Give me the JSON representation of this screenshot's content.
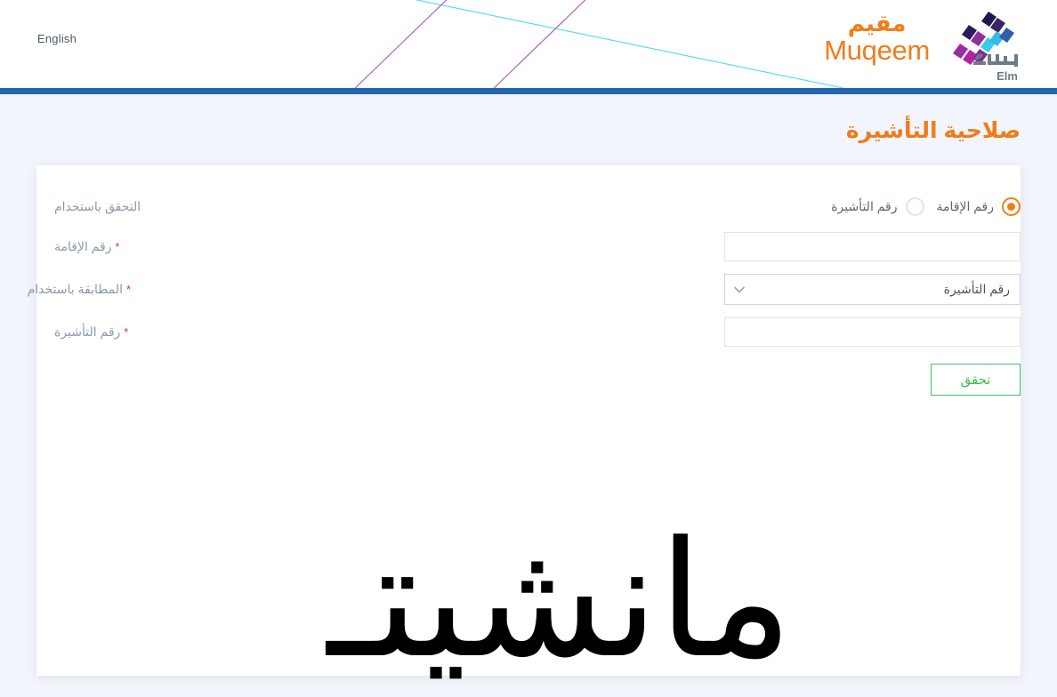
{
  "header": {
    "language_link": "English",
    "brand": {
      "name_ar": "مقيم",
      "name_en": "Muqeem",
      "partner_name": "Elm"
    },
    "accent_color": "#f07d1b",
    "bar_color": "#2566b0",
    "deco_line_colors": [
      "#4fd8f0",
      "#a855c7"
    ]
  },
  "page": {
    "title": "صلاحية التأشيرة",
    "background": "#f2f5fb"
  },
  "form": {
    "method_row": {
      "label": "التحقق باستخدام",
      "options": [
        {
          "label": "رقم الإقامة",
          "selected": true
        },
        {
          "label": "رقم التأشيرة",
          "selected": false
        }
      ]
    },
    "fields": [
      {
        "label": "رقم الإقامة",
        "required_mark": "*",
        "type": "text",
        "value": "",
        "placeholder": ""
      },
      {
        "label": "المطابقة باستخدام",
        "required_mark": "*",
        "type": "select",
        "value": "رقم التأشيرة",
        "icon": "chevron-down-icon"
      },
      {
        "label": "رقم التأشيرة",
        "required_mark": "*",
        "type": "text",
        "value": "",
        "placeholder": ""
      }
    ],
    "submit": {
      "label": "تحقق",
      "color": "#2fc14f",
      "border_color": "#3bc75f"
    }
  },
  "watermark": {
    "text": "مانشيتـ",
    "color": "#000000"
  }
}
